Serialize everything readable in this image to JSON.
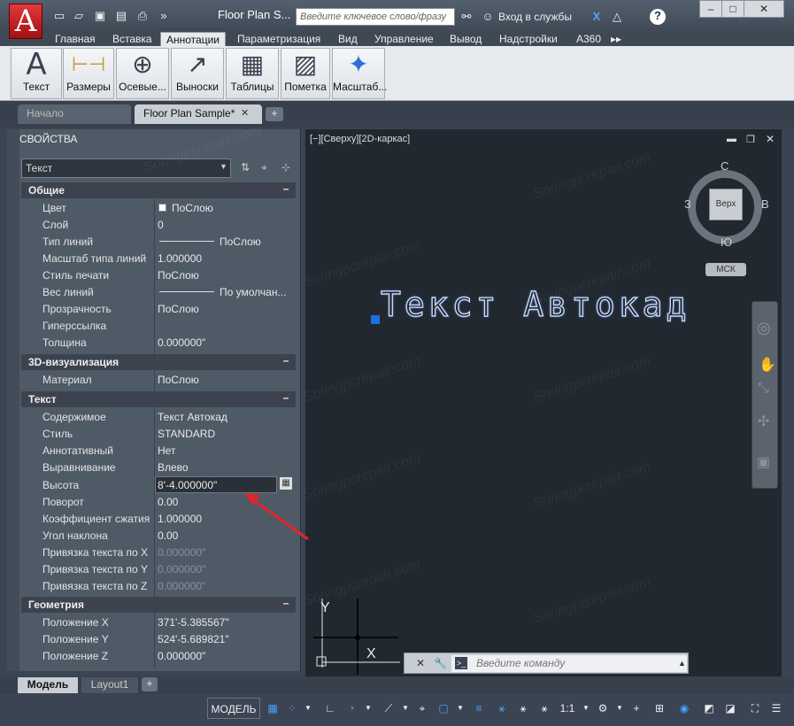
{
  "app": {
    "logo_letter": "A",
    "document_title": "Floor Plan S...",
    "search_placeholder": "Введите ключевое слово/фразу",
    "signin_label": "Вход в службы",
    "help_label": "?"
  },
  "quick_access": [
    "new-icon",
    "open-icon",
    "save-icon",
    "saveas-icon",
    "print-icon",
    "more-icon"
  ],
  "ribbon_tabs": [
    "Главная",
    "Вставка",
    "Аннотации",
    "Параметризация",
    "Вид",
    "Управление",
    "Вывод",
    "Надстройки",
    "A360"
  ],
  "active_ribbon_tab": "Аннотации",
  "ribbon_buttons": [
    {
      "label": "Текст",
      "icon": "text-icon",
      "glyph": "A"
    },
    {
      "label": "Размеры",
      "icon": "dimension-icon",
      "glyph": "⊢⊣"
    },
    {
      "label": "Осевые...",
      "icon": "centerline-icon",
      "glyph": "⊕"
    },
    {
      "label": "Выноски",
      "icon": "leader-icon",
      "glyph": "↗"
    },
    {
      "label": "Таблицы",
      "icon": "table-icon",
      "glyph": "▦"
    },
    {
      "label": "Пометка",
      "icon": "markup-icon",
      "glyph": "▨"
    },
    {
      "label": "Масштаб...",
      "icon": "scale-icon",
      "glyph": "✦"
    }
  ],
  "file_tabs": [
    {
      "label": "Начало"
    },
    {
      "label": "Floor Plan Sample*"
    }
  ],
  "properties": {
    "title": "СВОЙСТВА",
    "selection": "Текст",
    "sections": {
      "general": {
        "title": "Общие",
        "rows": [
          [
            "Цвет",
            "ПоСлою"
          ],
          [
            "Слой",
            "0"
          ],
          [
            "Тип линий",
            "ПоСлою"
          ],
          [
            "Масштаб типа линий",
            "1.000000"
          ],
          [
            "Стиль печати",
            "ПоСлою"
          ],
          [
            "Вес линий",
            "По умолчан..."
          ],
          [
            "Прозрачность",
            "ПоСлою"
          ],
          [
            "Гиперссылка",
            ""
          ],
          [
            "Толщина",
            "0.000000\""
          ]
        ]
      },
      "viz3d": {
        "title": "3D-визуализация",
        "rows": [
          [
            "Материал",
            "ПоСлою"
          ]
        ]
      },
      "text": {
        "title": "Текст",
        "rows": [
          [
            "Содержимое",
            "Текст Автокад"
          ],
          [
            "Стиль",
            "STANDARD"
          ],
          [
            "Аннотативный",
            "Нет"
          ],
          [
            "Выравнивание",
            "Влево"
          ],
          [
            "Высота",
            "8'-4.000000\""
          ],
          [
            "Поворот",
            "0.00"
          ],
          [
            "Коэффициент сжатия",
            "1.000000"
          ],
          [
            "Угол наклона",
            "0.00"
          ],
          [
            "Привязка текста по X",
            "0.000000\""
          ],
          [
            "Привязка текста по Y",
            "0.000000\""
          ],
          [
            "Привязка текста по Z",
            "0.000000\""
          ]
        ]
      },
      "geometry": {
        "title": "Геометрия",
        "rows": [
          [
            "Положение X",
            "371'-5.385567\""
          ],
          [
            "Положение Y",
            "524'-5.689821\""
          ],
          [
            "Положение Z",
            "0.000000\""
          ]
        ]
      }
    }
  },
  "viewport": {
    "label": "[−][Сверху][2D-каркас]",
    "canvas_text": "Текст Автокад",
    "viewcube": {
      "north": "С",
      "south": "Ю",
      "east": "В",
      "west": "З",
      "face": "Верх",
      "ucs": "МСК"
    },
    "ucs_y": "Y",
    "ucs_x": "X",
    "command_placeholder": "Введите команду"
  },
  "layout_tabs": [
    "Модель",
    "Layout1"
  ],
  "status": {
    "model": "МОДЕЛЬ",
    "scale": "1:1"
  },
  "watermark": "Soringpcrepair.com",
  "colors": {
    "accent_blue": "#1e6fe0",
    "arrow_red": "#e0262a",
    "canvas_bg": "#212830"
  }
}
